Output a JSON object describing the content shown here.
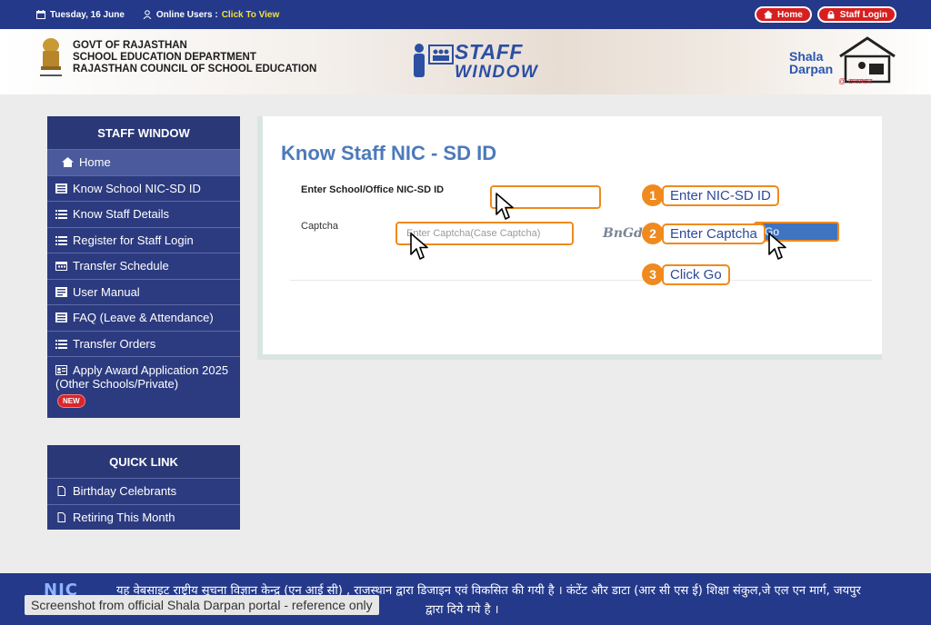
{
  "topbar": {
    "date": "Tuesday, 16 June",
    "online_label": "Online Users :",
    "online_cta": "Click To View",
    "home_btn": "Home",
    "staff_login_btn": "Staff Login"
  },
  "header": {
    "govt_line1": "GOVT OF RAJASTHAN",
    "govt_line2": "SCHOOL EDUCATION DEPARTMENT",
    "govt_line3": "RAJASTHAN COUNCIL OF SCHOOL EDUCATION",
    "logo_line1": "STAFF",
    "logo_line2": "WINDOW",
    "shala_line1": "Shala",
    "shala_line2": "Darpan",
    "shala_sub": "@ राजस्थान"
  },
  "sidebar": {
    "heading": "STAFF WINDOW",
    "items": [
      {
        "label": "Home"
      },
      {
        "label": "Know School NIC-SD ID"
      },
      {
        "label": "Know Staff Details"
      },
      {
        "label": "Register for Staff Login"
      },
      {
        "label": "Transfer Schedule"
      },
      {
        "label": "User Manual"
      },
      {
        "label": "FAQ (Leave & Attendance)"
      },
      {
        "label": "Transfer Orders"
      },
      {
        "label": "Apply Award Application 2025",
        "sub": "(Other Schools/Private)",
        "badge": "NEW"
      }
    ]
  },
  "quicklink": {
    "heading": "QUICK LINK",
    "items": [
      {
        "label": "Birthday Celebrants"
      },
      {
        "label": "Retiring This Month"
      }
    ]
  },
  "main": {
    "title": "Know Staff NIC - SD ID",
    "field1_label": "Enter School/Office NIC-SD ID",
    "field1_value": "",
    "field2_label": "Captcha",
    "field2_placeholder": "Enter Captcha(Case Captcha)",
    "captcha_text": "BnGdal",
    "go_label": "Go"
  },
  "steps": [
    {
      "num": "1",
      "text": "Enter NIC-SD ID"
    },
    {
      "num": "2",
      "text": "Enter Captcha"
    },
    {
      "num": "3",
      "text": "Click Go"
    }
  ],
  "footer": {
    "line1": "यह वेबसाइट राष्ट्रीय सूचना विज्ञान केन्द्र (एन आई सी) , राजस्थान द्वारा डिजाइन एवं विकसित की गयी है । कंटेंट और डाटा (आर सी एस ई) शिक्षा संकुल,जे एल एन मार्ग, जयपुर",
    "line2": "द्वारा दिये गये है ।",
    "nic": "NIC"
  },
  "watermark": "Screenshot from official Shala Darpan portal - reference only",
  "colors": {
    "navy": "#24398a",
    "sidebar": "#2c3b80",
    "accent_orange": "#ef8a1e",
    "title_blue": "#4c7aba",
    "alert_red": "#d71f1f"
  }
}
